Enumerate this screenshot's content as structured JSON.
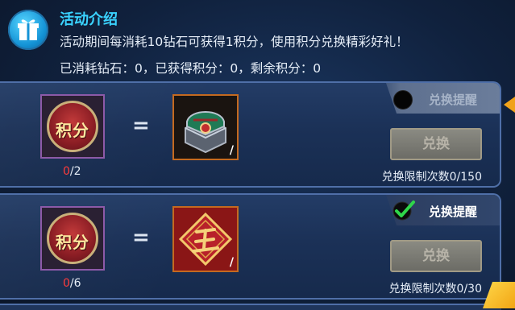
{
  "header": {
    "title": "活动介绍",
    "description": "活动期间每消耗10钻石可获得1积分，使用积分兑换精彩好礼！",
    "stats": "已消耗钻石：0，已获得积分：0，剩余积分：0",
    "icon": "gift-icon"
  },
  "rows": [
    {
      "badge_label": "积分",
      "count_current": "0",
      "count_total": "/2",
      "equals": "=",
      "reward_icon": "treasure-chest-icon",
      "reward_qty": "/",
      "remind_label": "兑换提醒",
      "remind_on": false,
      "button_label": "兑换",
      "limit_text": "兑换限制次数0/150"
    },
    {
      "badge_label": "积分",
      "count_current": "0",
      "count_total": "/6",
      "equals": "=",
      "reward_icon": "king-token-icon",
      "reward_qty": "/",
      "remind_label": "兑换提醒",
      "remind_on": true,
      "button_label": "兑换",
      "limit_text": "兑换限制次数0/30"
    }
  ],
  "colors": {
    "title": "#3ad3ff",
    "count_red": "#ff3b3b",
    "check_green": "#2fd64a"
  }
}
